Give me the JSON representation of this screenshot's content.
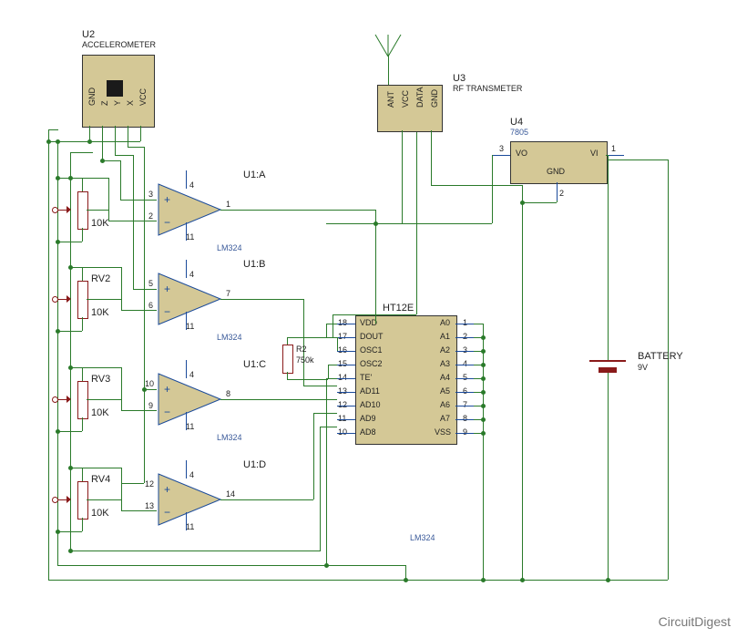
{
  "components": {
    "u2": {
      "ref": "U2",
      "name": "ACCELEROMETER",
      "pins": [
        "GND",
        "Z",
        "Y",
        "X",
        "VCC"
      ]
    },
    "u3": {
      "ref": "U3",
      "name": "RF TRANSMETER",
      "pins": [
        "ANT",
        "VCC",
        "DATA",
        "GND"
      ]
    },
    "u4": {
      "ref": "U4",
      "name": "7805",
      "pins": {
        "vo": "VO",
        "vi": "VI",
        "gnd": "GND",
        "vo_n": "3",
        "vi_n": "1",
        "gnd_n": "2"
      }
    },
    "u1a": {
      "ref": "U1:A",
      "name": "LM324",
      "in_p": "3",
      "in_n": "2",
      "out": "1",
      "vp": "4",
      "vn": "11"
    },
    "u1b": {
      "ref": "U1:B",
      "name": "LM324",
      "in_p": "5",
      "in_n": "6",
      "out": "7",
      "vp": "4",
      "vn": "11"
    },
    "u1c": {
      "ref": "U1:C",
      "name": "LM324",
      "in_p": "10",
      "in_n": "9",
      "out": "8",
      "vp": "4",
      "vn": "11"
    },
    "u1d": {
      "ref": "U1:D",
      "name": "LM324",
      "in_p": "12",
      "in_n": "13",
      "out": "14",
      "vp": "4",
      "vn": "11"
    },
    "ht12e": {
      "ref": "HT12E",
      "left_pins": [
        {
          "n": "18",
          "name": "VDD"
        },
        {
          "n": "17",
          "name": "DOUT"
        },
        {
          "n": "16",
          "name": "OSC1"
        },
        {
          "n": "15",
          "name": "OSC2"
        },
        {
          "n": "14",
          "name": "TE'"
        },
        {
          "n": "13",
          "name": "AD11"
        },
        {
          "n": "12",
          "name": "AD10"
        },
        {
          "n": "11",
          "name": "AD9"
        },
        {
          "n": "10",
          "name": "AD8"
        }
      ],
      "right_pins": [
        {
          "n": "1",
          "name": "A0"
        },
        {
          "n": "2",
          "name": "A1"
        },
        {
          "n": "3",
          "name": "A2"
        },
        {
          "n": "4",
          "name": "A3"
        },
        {
          "n": "5",
          "name": "A4"
        },
        {
          "n": "6",
          "name": "A5"
        },
        {
          "n": "7",
          "name": "A6"
        },
        {
          "n": "8",
          "name": "A7"
        },
        {
          "n": "9",
          "name": "VSS"
        }
      ]
    },
    "rv1": {
      "ref": "",
      "val": "10K"
    },
    "rv2": {
      "ref": "RV2",
      "val": "10K"
    },
    "rv3": {
      "ref": "RV3",
      "val": "10K"
    },
    "rv4": {
      "ref": "RV4",
      "val": "10K"
    },
    "r2": {
      "ref": "R2",
      "val": "750k"
    },
    "battery": {
      "ref": "BATTERY",
      "val": "9V"
    }
  },
  "watermark": "CircuitDigest"
}
